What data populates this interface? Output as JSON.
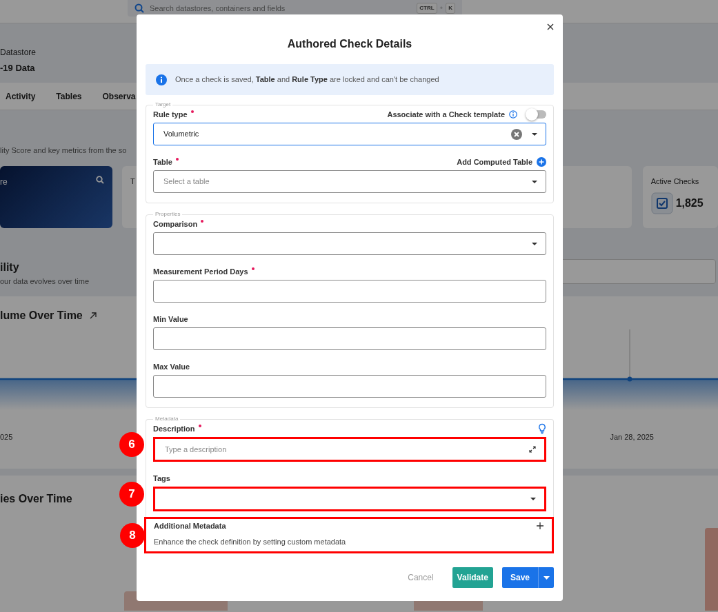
{
  "top_bar": {
    "search_placeholder": "Search datastores, containers and fields",
    "shortcut_keys": [
      "CTRL",
      "K"
    ],
    "shortcut_separator": "+"
  },
  "background": {
    "datastore_label": "Datastore",
    "datastore_name": "-19 Data",
    "tabs": [
      "Activity",
      "Tables",
      "Observa"
    ],
    "overview_subtitle": "lity Score and key metrics from the so",
    "score_card": {
      "title": "re"
    },
    "second_card": {
      "title": "T"
    },
    "active_checks": {
      "title": "Active Checks",
      "value": "1,825"
    },
    "section_title": "ility",
    "section_subtitle": "our data evolves over time",
    "volume_chart": {
      "title": "lume Over Time",
      "x_labels": [
        "025",
        "Jan 28, 2025"
      ]
    },
    "anomalies_chart": {
      "title": "ies Over Time"
    }
  },
  "modal": {
    "title": "Authored Check Details",
    "alert": "Once a check is saved, **Table** and **Rule Type** are locked and can't be changed",
    "sections": [
      {
        "legend": "Target",
        "fields": [
          {
            "label": "Rule type",
            "required": true,
            "kind": "select",
            "value": "Volumetric",
            "focused": true,
            "clearable": true,
            "header_action": {
              "kind": "toggle",
              "text": "Associate with a Check template",
              "on": false
            }
          },
          {
            "label": "Table",
            "required": true,
            "kind": "select",
            "placeholder": "Select a table",
            "header_action": {
              "kind": "add",
              "text": "Add Computed Table"
            }
          }
        ]
      },
      {
        "legend": "Properties",
        "fields": [
          {
            "label": "Comparison",
            "required": true,
            "kind": "select"
          },
          {
            "label": "Measurement Period Days",
            "required": true,
            "kind": "text"
          },
          {
            "label": "Min Value",
            "required": false,
            "kind": "text"
          },
          {
            "label": "Max Value",
            "required": false,
            "kind": "text"
          }
        ]
      },
      {
        "legend": "Metadata",
        "fields": [
          {
            "label": "Description",
            "required": true,
            "kind": "textarea",
            "placeholder": "Type a description",
            "annotation": "6",
            "header_action": {
              "kind": "hint"
            }
          },
          {
            "label": "Tags",
            "required": false,
            "kind": "select",
            "annotation": "7"
          }
        ],
        "extra": {
          "title": "Additional Metadata",
          "text": "Enhance the check definition by setting custom metadata",
          "annotation": "8"
        }
      }
    ],
    "buttons": [
      {
        "label": "Cancel",
        "kind": "link"
      },
      {
        "label": "Validate",
        "kind": "success"
      },
      {
        "label": "Save",
        "kind": "split"
      }
    ]
  }
}
